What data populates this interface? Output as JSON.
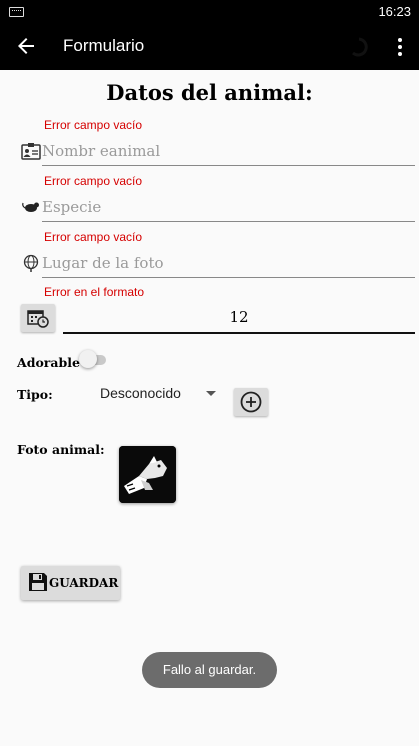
{
  "status_bar": {
    "time": "16:23",
    "keyboard_icon": "keyboard-icon"
  },
  "app_bar": {
    "title": "Formulario",
    "back_icon": "arrow-back-icon",
    "menu_icon": "more-vert-icon"
  },
  "form": {
    "heading": "Datos del animal:",
    "name": {
      "error": "Error campo vacío",
      "placeholder": "Nombr eanimal",
      "icon": "id-card-icon"
    },
    "species": {
      "error": "Error campo vacío",
      "placeholder": "Especie",
      "icon": "rat-icon"
    },
    "place": {
      "error": "Error campo vacío",
      "placeholder": "Lugar de la foto",
      "icon": "globe-pin-icon"
    },
    "date": {
      "error": "Error en el formato",
      "value": "12",
      "icon": "calendar-clock-icon"
    },
    "adorable": {
      "label": "Adorable",
      "checked": false
    },
    "type": {
      "label": "Tipo:",
      "selected": "Desconocido",
      "add_icon": "add-circle-icon"
    },
    "photo": {
      "label": "Foto animal:"
    },
    "save_button": {
      "label": "GUARDAR",
      "icon": "floppy-disk-icon"
    }
  },
  "toast": {
    "message": "Fallo al guardar."
  }
}
